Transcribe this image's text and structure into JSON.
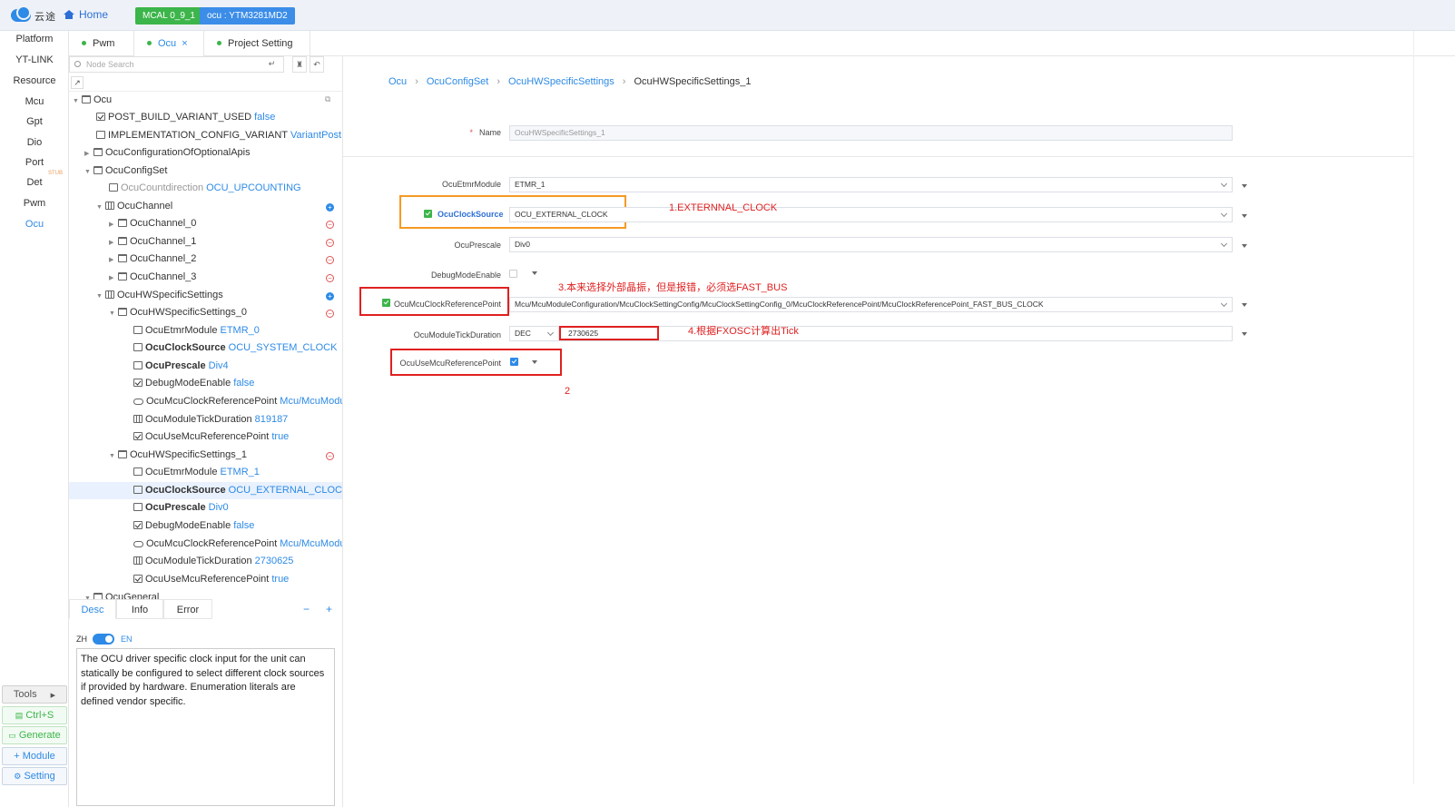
{
  "topbar": {
    "logo_text": "云途",
    "home": "Home",
    "badge_mcal": "MCAL 0_9_1",
    "badge_ocu": "ocu : YTM3281MD2"
  },
  "rail": {
    "items": [
      "Platform",
      "YT-LINK",
      "Resource",
      "Mcu",
      "Gpt",
      "Dio",
      "Port",
      "Det",
      "Pwm",
      "Ocu"
    ],
    "tiny_label": "STUB",
    "buttons": {
      "tools": "Tools",
      "save": "Ctrl+S",
      "generate": "Generate",
      "module": "Module",
      "setting": "Setting"
    }
  },
  "tabs": [
    {
      "label": "Pwm"
    },
    {
      "label": "Ocu",
      "close": "×"
    },
    {
      "label": "Project Setting"
    }
  ],
  "tree": {
    "search_placeholder": "Node Search",
    "nodes": [
      {
        "label": "Ocu",
        "value": ""
      },
      {
        "label": "POST_BUILD_VARIANT_USED",
        "value": "false"
      },
      {
        "label": "IMPLEMENTATION_CONFIG_VARIANT",
        "value": "VariantPostBuild"
      },
      {
        "label": "OcuConfigurationOfOptionalApis",
        "value": ""
      },
      {
        "label": "OcuConfigSet",
        "value": ""
      },
      {
        "label": "OcuCountdirection",
        "value": "OCU_UPCOUNTING"
      },
      {
        "label": "OcuChannel",
        "value": ""
      },
      {
        "label": "OcuChannel_0",
        "value": ""
      },
      {
        "label": "OcuChannel_1",
        "value": ""
      },
      {
        "label": "OcuChannel_2",
        "value": ""
      },
      {
        "label": "OcuChannel_3",
        "value": ""
      },
      {
        "label": "OcuHWSpecificSettings",
        "value": ""
      },
      {
        "label": "OcuHWSpecificSettings_0",
        "value": ""
      },
      {
        "label": "OcuEtmrModule",
        "value": "ETMR_0"
      },
      {
        "label": "OcuClockSource",
        "value": "OCU_SYSTEM_CLOCK"
      },
      {
        "label": "OcuPrescale",
        "value": "Div4"
      },
      {
        "label": "DebugModeEnable",
        "value": "false"
      },
      {
        "label": "OcuMcuClockReferencePoint",
        "value": "Mcu/McuModuleConfiguration"
      },
      {
        "label": "OcuModuleTickDuration",
        "value": "819187"
      },
      {
        "label": "OcuUseMcuReferencePoint",
        "value": "true"
      },
      {
        "label": "OcuHWSpecificSettings_1",
        "value": ""
      },
      {
        "label": "OcuEtmrModule",
        "value": "ETMR_1"
      },
      {
        "label": "OcuClockSource",
        "value": "OCU_EXTERNAL_CLOCK"
      },
      {
        "label": "OcuPrescale",
        "value": "Div0"
      },
      {
        "label": "DebugModeEnable",
        "value": "false"
      },
      {
        "label": "OcuMcuClockReferencePoint",
        "value": "Mcu/McuModuleConfiguration"
      },
      {
        "label": "OcuModuleTickDuration",
        "value": "2730625"
      },
      {
        "label": "OcuUseMcuReferencePoint",
        "value": "true"
      },
      {
        "label": "OcuGeneral",
        "value": ""
      }
    ]
  },
  "desc": {
    "tabs": [
      "Desc",
      "Info",
      "Error"
    ],
    "lang_zh": "ZH",
    "lang_en": "EN",
    "text": "The OCU driver specific clock input for the unit can statically be configured to select different clock sources if provided by hardware. Enumeration literals are defined vendor specific."
  },
  "breadcrumb": [
    "Ocu",
    "OcuConfigSet",
    "OcuHWSpecificSettings",
    "OcuHWSpecificSettings_1"
  ],
  "form": {
    "name_label": "Name",
    "name_value": "OcuHWSpecificSettings_1",
    "etmr_label": "OcuEtmrModule",
    "etmr_value": "ETMR_1",
    "clock_label": "OcuClockSource",
    "clock_value": "OCU_EXTERNAL_CLOCK",
    "prescale_label": "OcuPrescale",
    "prescale_value": "Div0",
    "debug_label": "DebugModeEnable",
    "refpoint_label": "OcuMcuClockReferencePoint",
    "refpoint_value": "Mcu/McuModuleConfiguration/McuClockSettingConfig/McuClockSettingConfig_0/McuClockReferencePoint/McuClockReferencePoint_FAST_BUS_CLOCK",
    "tick_label": "OcuModuleTickDuration",
    "tick_base": "DEC",
    "tick_value": "2730625",
    "usemcu_label": "OcuUseMcuReferencePoint"
  },
  "annotations": {
    "a1": "1.EXTERNNAL_CLOCK",
    "a3": "3.本来选择外部晶振，但是报错，必须选FAST_BUS",
    "a4": "4.根据FXOSC计算出Tick",
    "a2": "2"
  },
  "colors": {
    "accent": "#2d8ae6",
    "green": "#3cb54a",
    "annotation_red": "#e02020",
    "annotation_orange": "#f59a23"
  }
}
